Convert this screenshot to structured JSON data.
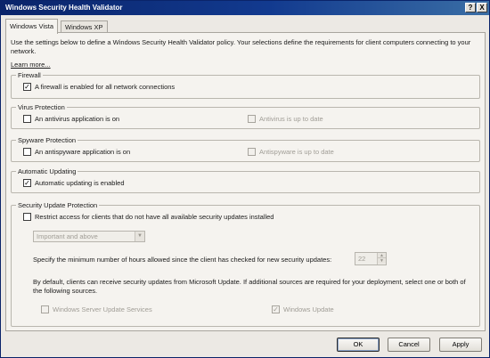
{
  "window": {
    "title": "Windows Security Health Validator",
    "help_button": "?",
    "close_button": "X"
  },
  "tabs": [
    {
      "label": "Windows Vista",
      "active": true
    },
    {
      "label": "Windows XP",
      "active": false
    }
  ],
  "intro": {
    "text": "Use the settings below to define a Windows Security Health Validator policy. Your selections define the requirements for client computers connecting to your network.",
    "learn_more": "Learn more..."
  },
  "firewall": {
    "group_label": "Firewall",
    "checkbox_label": "A firewall is enabled for all network connections",
    "checked": true
  },
  "virus": {
    "group_label": "Virus Protection",
    "main_label": "An antivirus application is on",
    "main_checked": false,
    "secondary_label": "Antivirus is up to date",
    "secondary_checked": false
  },
  "spyware": {
    "group_label": "Spyware Protection",
    "main_label": "An antispyware application is on",
    "main_checked": false,
    "secondary_label": "Antispyware is up to date",
    "secondary_checked": false
  },
  "updating": {
    "group_label": "Automatic Updating",
    "checkbox_label": "Automatic updating is enabled",
    "checked": true
  },
  "security_updates": {
    "group_label": "Security Update Protection",
    "restrict_label": "Restrict access for clients that do not have all available security updates installed",
    "restrict_checked": false,
    "severity_value": "Important and above",
    "hours_label": "Specify the minimum number of hours allowed since the client has checked for new security updates:",
    "hours_value": "22",
    "sources_text": "By default, clients can receive security updates from Microsoft Update.  If additional sources are required for your deployment, select one or both of the following sources.",
    "wsus_label": "Windows Server Update Services",
    "wsus_checked": false,
    "wu_label": "Windows Update",
    "wu_checked": true
  },
  "buttons": {
    "ok": "OK",
    "cancel": "Cancel",
    "apply": "Apply"
  },
  "glyphs": {
    "check": "✓",
    "dropdown": "▼",
    "up": "▲",
    "down": "▼"
  }
}
